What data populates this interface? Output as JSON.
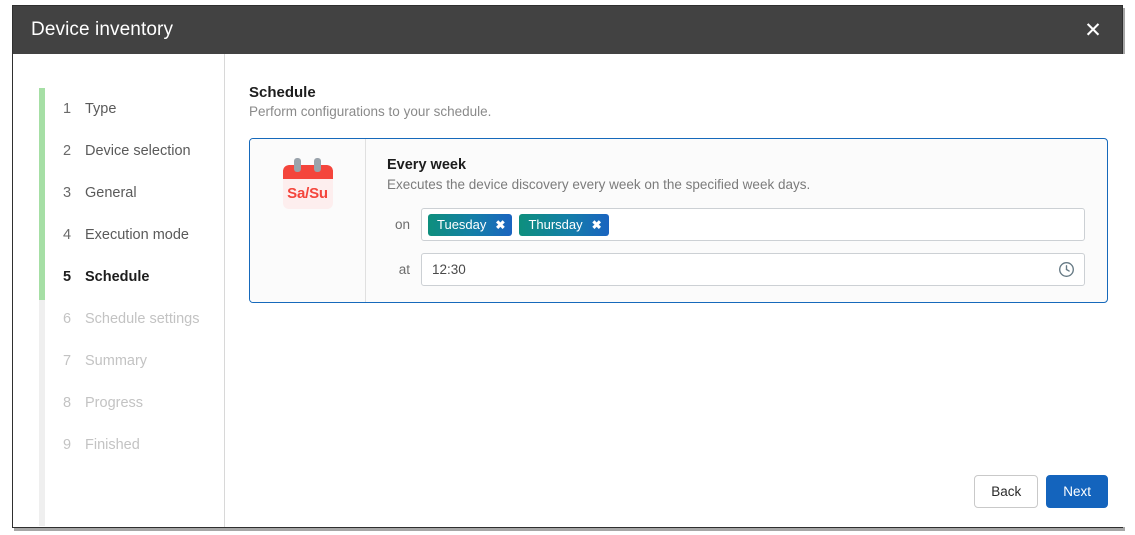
{
  "window": {
    "title": "Device inventory",
    "close_icon": "close-icon"
  },
  "sidebar": {
    "steps": [
      {
        "num": "1",
        "label": "Type",
        "state": "done"
      },
      {
        "num": "2",
        "label": "Device selection",
        "state": "done"
      },
      {
        "num": "3",
        "label": "General",
        "state": "done"
      },
      {
        "num": "4",
        "label": "Execution mode",
        "state": "done"
      },
      {
        "num": "5",
        "label": "Schedule",
        "state": "active"
      },
      {
        "num": "6",
        "label": "Schedule settings",
        "state": "disabled"
      },
      {
        "num": "7",
        "label": "Summary",
        "state": "disabled"
      },
      {
        "num": "8",
        "label": "Progress",
        "state": "disabled"
      },
      {
        "num": "9",
        "label": "Finished",
        "state": "disabled"
      }
    ],
    "progress_color": "#a6dfa5",
    "track_color": "#efefef"
  },
  "main": {
    "title": "Schedule",
    "subtitle": "Perform configurations to your schedule.",
    "card": {
      "icon_name": "calendar-weekday-icon",
      "icon_text": "Sa/Su",
      "icon_accent": "#f4453c",
      "heading": "Every week",
      "description": "Executes the device discovery every week on the specified week days.",
      "on_label": "on",
      "day_tags": [
        {
          "label": "Tuesday",
          "remove_icon": "✖"
        },
        {
          "label": "Thursday",
          "remove_icon": "✖"
        }
      ],
      "at_label": "at",
      "time_value": "12:30",
      "time_placeholder": "hh:mm",
      "time_icon": "clock-icon",
      "border_color": "#1669bb",
      "chip_gradient_from": "#0e8f7d",
      "chip_gradient_to": "#1a64c0"
    }
  },
  "footer": {
    "back_label": "Back",
    "next_label": "Next",
    "primary_color": "#1464bd"
  }
}
